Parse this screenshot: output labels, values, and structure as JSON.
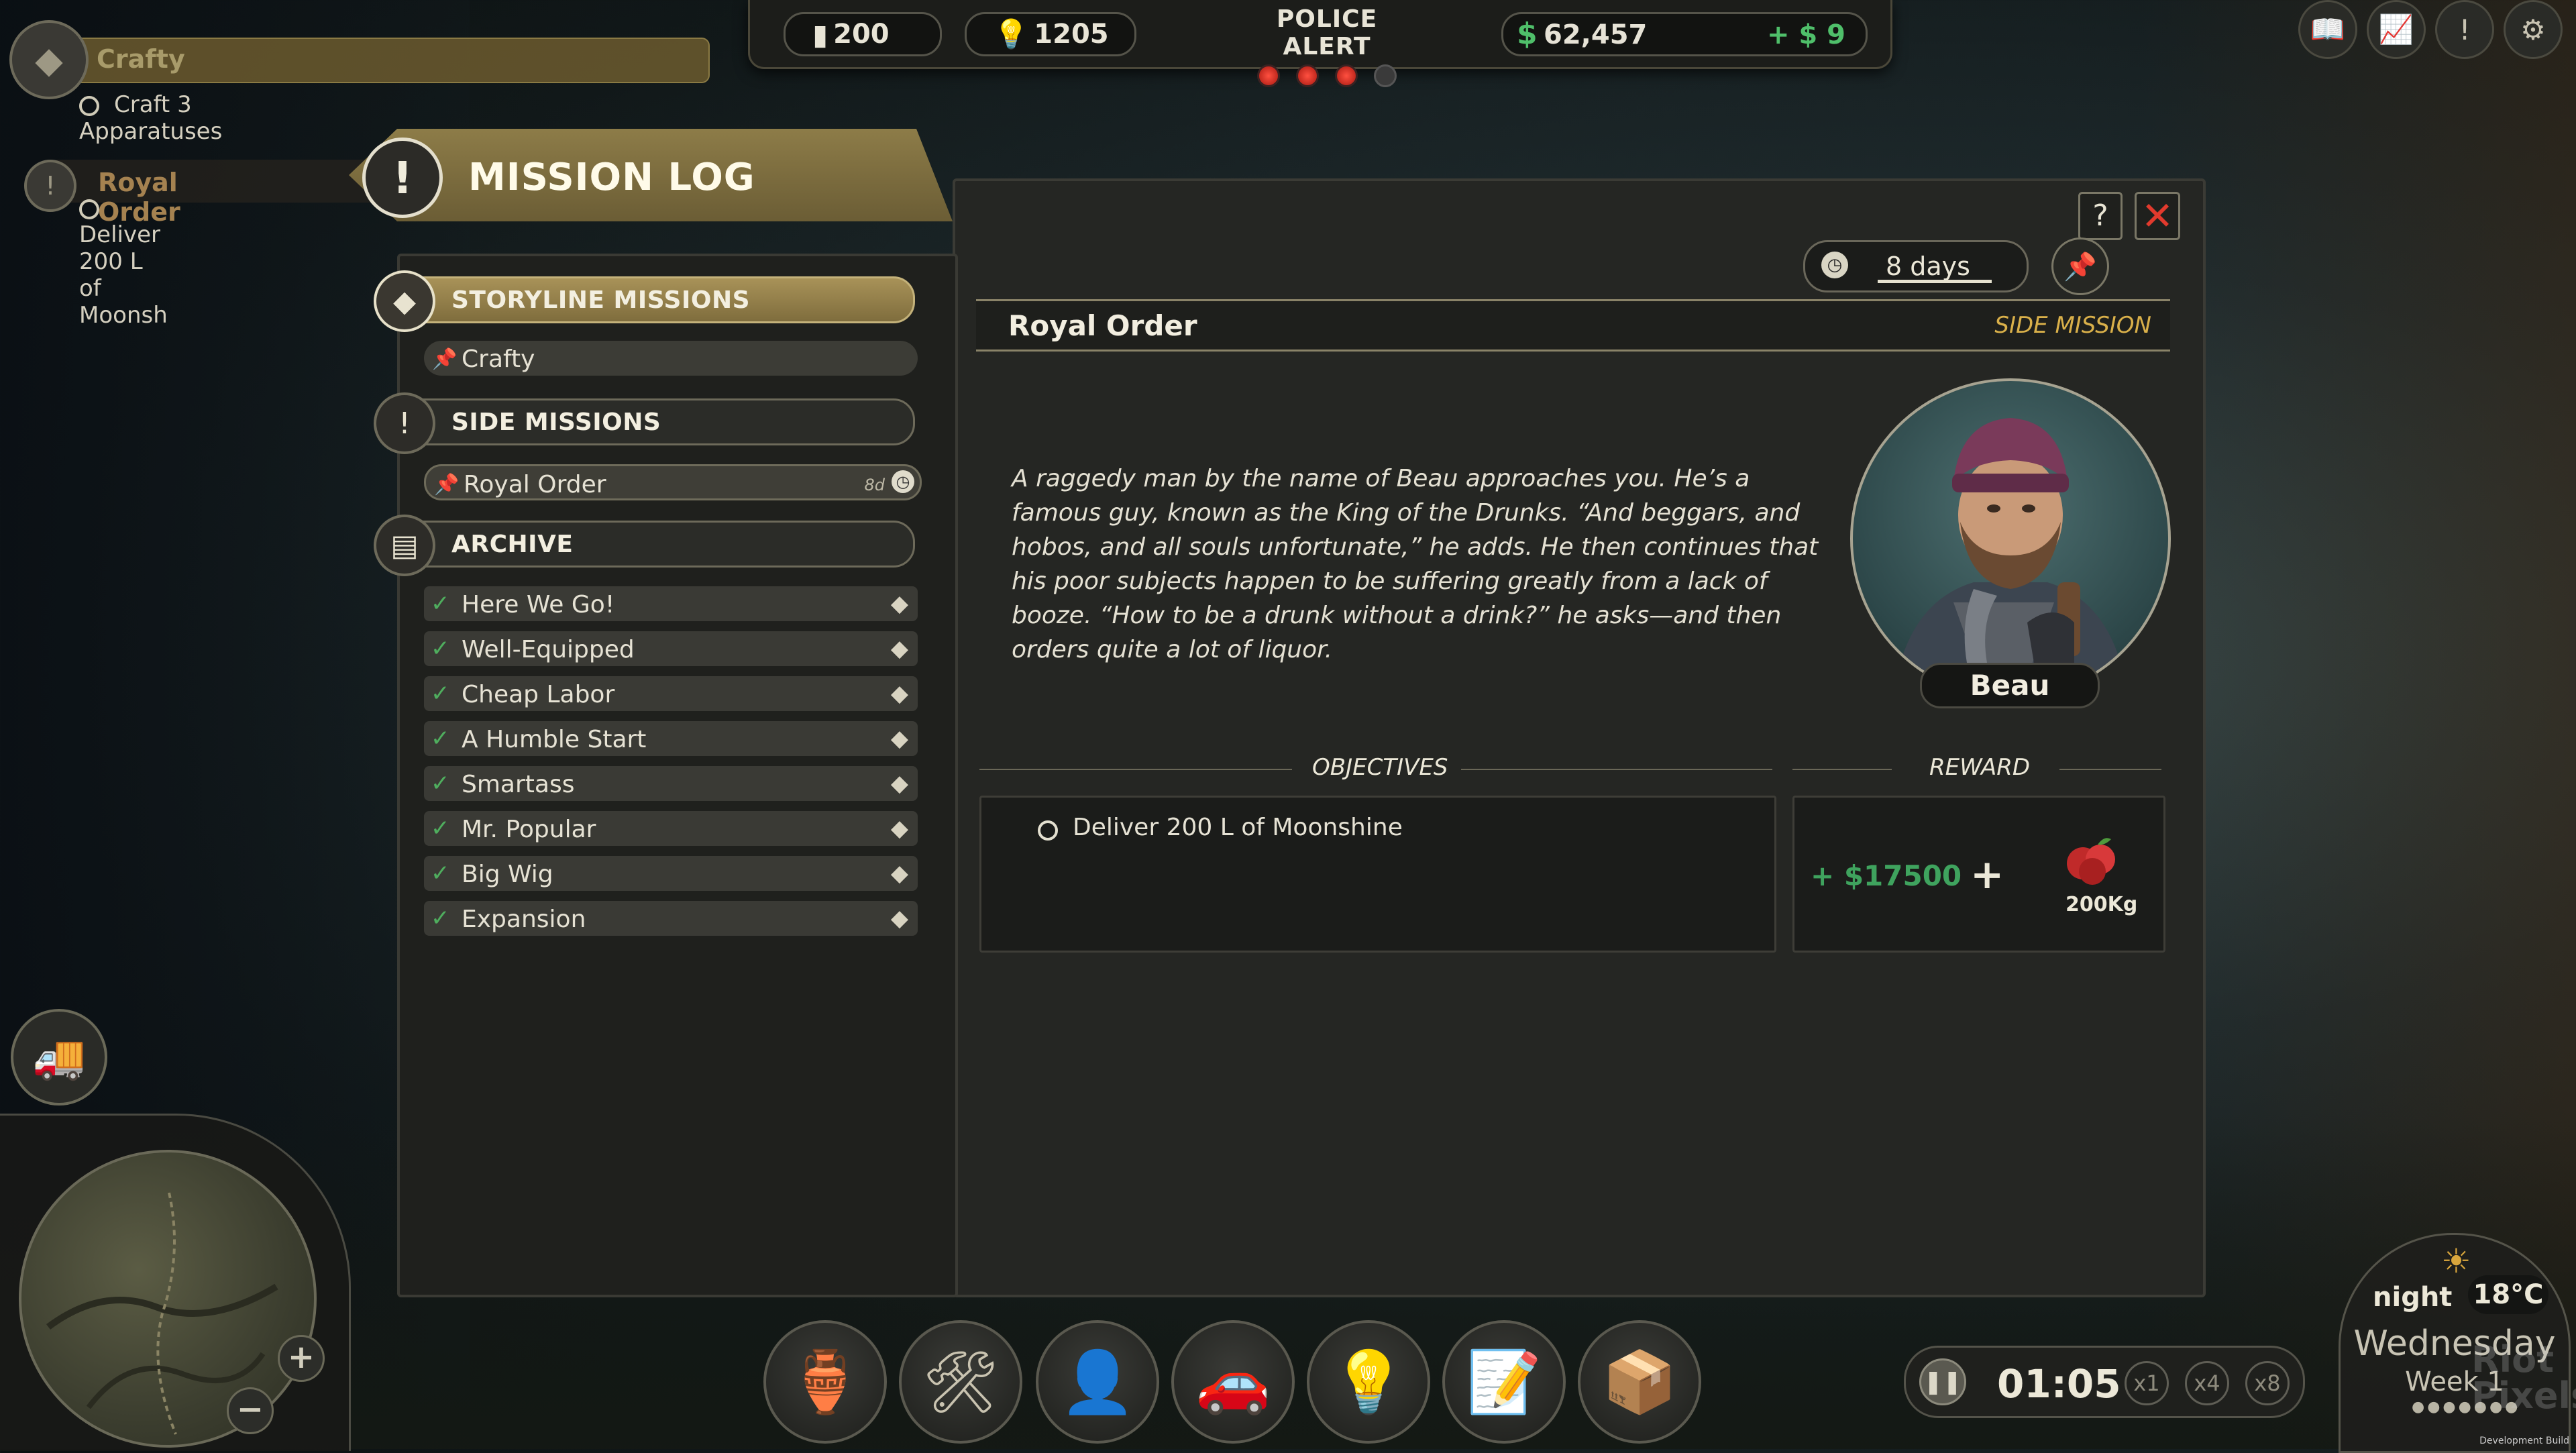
{
  "resources": {
    "storage": "200",
    "research": "1205",
    "police_alert_label": "POLICE ALERT",
    "police_alert_level": 3,
    "police_alert_max": 4,
    "money": "62,457",
    "income": "+ $ 9",
    "currency_symbol": "$"
  },
  "tracker": {
    "mission1_title": "Crafty",
    "mission1_objective": "Craft 3 Apparatuses",
    "mission2_title": "Royal Order",
    "mission2_objective": "Deliver 200 L of Moonsh"
  },
  "mission_log": {
    "title": "MISSION LOG",
    "categories": {
      "storyline": "STORYLINE MISSIONS",
      "side": "SIDE MISSIONS",
      "archive": "ARCHIVE"
    },
    "storyline_missions": [
      {
        "label": "Crafty"
      }
    ],
    "side_missions": [
      {
        "label": "Royal Order",
        "days": "8d"
      }
    ],
    "archive": [
      {
        "label": "Here We Go!"
      },
      {
        "label": "Well-Equipped"
      },
      {
        "label": "Cheap Labor"
      },
      {
        "label": "A Humble Start"
      },
      {
        "label": "Smartass"
      },
      {
        "label": "Mr. Popular"
      },
      {
        "label": "Big Wig"
      },
      {
        "label": "Expansion"
      }
    ]
  },
  "detail": {
    "timer": "8 days",
    "title": "Royal Order",
    "type": "SIDE MISSION",
    "description": "A raggedy man by the name of Beau approaches you. He’s a famous guy, known as the King of the Drunks. “And beggars, and hobos, and all souls unfortunate,” he adds. He then continues that his poor subjects happen to be suffering greatly from a lack of booze. “How to be a drunk without a drink?” he asks—and then orders quite a lot of liquor.",
    "character_name": "Beau",
    "objectives_label": "OBJECTIVES",
    "reward_label": "REWARD",
    "objectives": [
      {
        "text": "Deliver 200 L of Moonshine"
      }
    ],
    "reward_money": "+ $17500",
    "reward_plus": "+",
    "reward_item_amount": "200Kg",
    "help_label": "?",
    "close_label": "✕"
  },
  "time": {
    "clock": "01:05",
    "speeds": [
      "x1",
      "x4",
      "x8"
    ],
    "time_of_day": "night",
    "temperature": "18°C",
    "day": "Wednesday",
    "week": "Week 1"
  },
  "watermark": "Riot\nPixels",
  "dev_build": "Development Build",
  "colors": {
    "accent_gold": "#a89258",
    "money_green": "#3fa35e",
    "alert_red": "#e23a2d",
    "side_mission_type": "#d9b04a"
  }
}
